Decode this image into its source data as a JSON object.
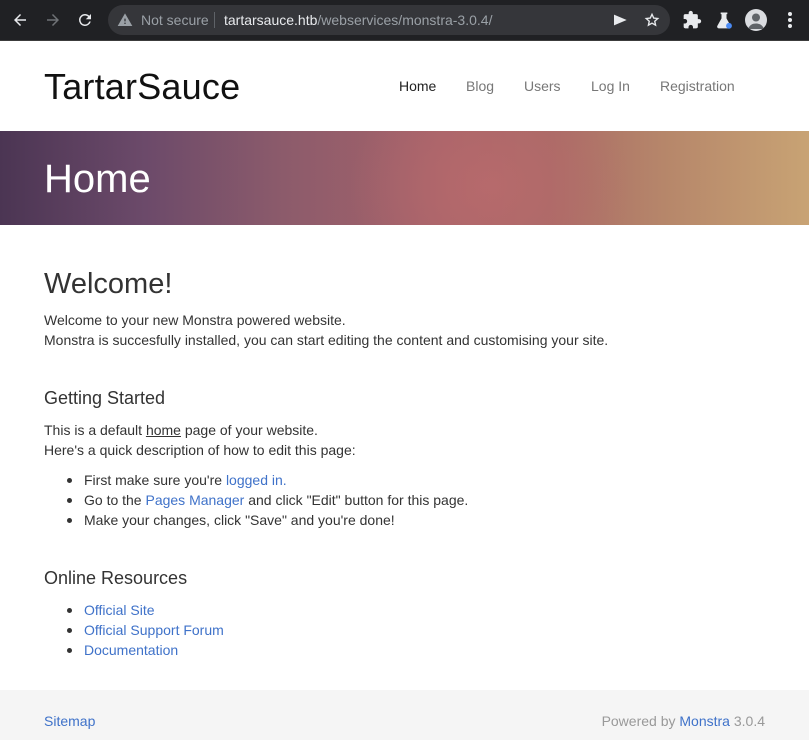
{
  "browser": {
    "security_label": "Not secure",
    "url_host": "tartarsauce.htb",
    "url_path": "/webservices/monstra-3.0.4/",
    "icons": [
      "back-icon",
      "forward-icon",
      "reload-icon",
      "warning-icon",
      "send-icon",
      "star-icon",
      "extensions-icon",
      "labs-icon",
      "profile-icon",
      "menu-icon"
    ]
  },
  "site": {
    "brand": "TartarSauce",
    "nav": [
      {
        "label": "Home",
        "active": true
      },
      {
        "label": "Blog",
        "active": false
      },
      {
        "label": "Users",
        "active": false
      },
      {
        "label": "Log In",
        "active": false
      },
      {
        "label": "Registration",
        "active": false
      }
    ],
    "hero_title": "Home"
  },
  "content": {
    "welcome_heading": "Welcome!",
    "welcome_line1": "Welcome to your new Monstra powered website.",
    "welcome_line2": "Monstra is succesfully installed, you can start editing the content and customising your site.",
    "getting_started_heading": "Getting Started",
    "gs_line1_pre": "This is a default ",
    "gs_line1_link": "home",
    "gs_line1_post": " page of your website.",
    "gs_line2": "Here's a quick description of how to edit this page:",
    "steps": [
      {
        "pre": "First make sure you're ",
        "link": "logged in.",
        "post": ""
      },
      {
        "pre": "Go to the ",
        "link": "Pages Manager",
        "post": " and click \"Edit\" button for this page."
      },
      {
        "pre": "Make your changes, click \"Save\" and you're done!",
        "link": "",
        "post": ""
      }
    ],
    "resources_heading": "Online Resources",
    "resources": [
      "Official Site",
      "Official Support Forum",
      "Documentation"
    ]
  },
  "footer": {
    "sitemap": "Sitemap",
    "powered_pre": "Powered by ",
    "powered_link": "Monstra",
    "powered_version": " 3.0.4"
  },
  "colors": {
    "link": "#3f72c9",
    "chrome_bg": "#202124",
    "omnibox_bg": "#35363a"
  }
}
